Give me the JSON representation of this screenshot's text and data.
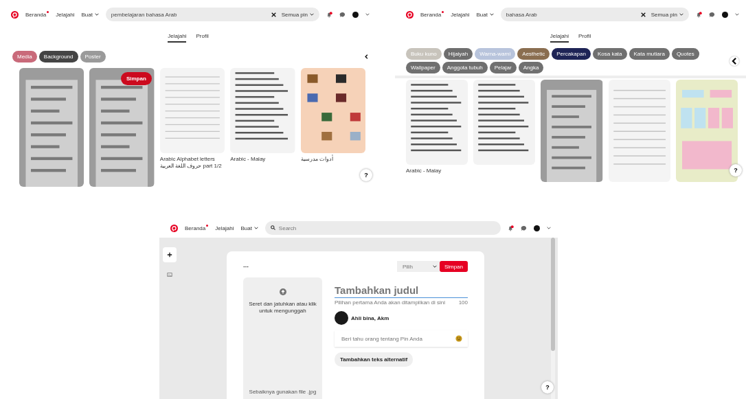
{
  "search_page_1": {
    "nav": [
      {
        "label": "Beranda",
        "kind": "link",
        "new_dot": true
      },
      {
        "label": "Jelajahi",
        "kind": "link",
        "new_dot": false
      },
      {
        "label": "Buat",
        "kind": "menu",
        "new_dot": false
      }
    ],
    "search": {
      "value": "pembelajaran bahasa Arab",
      "filter": "Semua pin"
    },
    "tabs": [
      {
        "label": "Jelajahi",
        "selected": true
      },
      {
        "label": "Profil",
        "selected": false
      }
    ],
    "chips": [
      {
        "label": "Media",
        "color": "#c96a7a"
      },
      {
        "label": "Background",
        "color": "#444444"
      },
      {
        "label": "Poster",
        "color": "#9a9a9a"
      }
    ],
    "pins": [
      {
        "kind": "picture"
      },
      {
        "kind": "picture",
        "save_button": "Simpan"
      },
      {
        "kind": "picture",
        "caption": "Arabic Alphabet letters حروف اللغة العربية part 1/2"
      },
      {
        "kind": "picture",
        "caption": "Arabic - Malay"
      },
      {
        "kind": "picture",
        "caption": "أدوات مدرسية"
      }
    ],
    "help": "?"
  },
  "search_page_2": {
    "nav": [
      {
        "label": "Beranda",
        "kind": "link",
        "new_dot": true
      },
      {
        "label": "Jelajahi",
        "kind": "link",
        "new_dot": false
      },
      {
        "label": "Buat",
        "kind": "menu",
        "new_dot": false
      }
    ],
    "search": {
      "value": "bahasa Arab",
      "filter": "Semua pin"
    },
    "tabs": [
      {
        "label": "Jelajahi",
        "selected": true
      },
      {
        "label": "Profil",
        "selected": false
      }
    ],
    "chips": [
      {
        "label": "Buku kuno",
        "color": "#c8c4bc"
      },
      {
        "label": "Hijaiyah",
        "color": "#6e6e6e"
      },
      {
        "label": "Warna-warni",
        "color": "#b8c4dc"
      },
      {
        "label": "Aesthetic",
        "color": "#8a6e50"
      },
      {
        "label": "Percakapan",
        "color": "#1e2456"
      },
      {
        "label": "Kosa kata",
        "color": "#707070"
      },
      {
        "label": "Kata mutiara",
        "color": "#707070"
      },
      {
        "label": "Quotes",
        "color": "#707070"
      },
      {
        "label": "Wallpaper",
        "color": "#707070"
      },
      {
        "label": "Anggota tubuh",
        "color": "#707070"
      },
      {
        "label": "Pelajar",
        "color": "#707070"
      },
      {
        "label": "Angka",
        "color": "#707070"
      }
    ],
    "pins": [
      {
        "kind": "picture",
        "caption": "Arabic - Malay"
      },
      {
        "kind": "picture"
      },
      {
        "kind": "picture"
      },
      {
        "kind": "picture"
      },
      {
        "kind": "picture"
      }
    ],
    "help": "?"
  },
  "create_pin_page": {
    "nav": [
      {
        "label": "Beranda",
        "kind": "link",
        "new_dot": true
      },
      {
        "label": "Jelajahi",
        "kind": "link",
        "new_dot": false
      },
      {
        "label": "Buat",
        "kind": "menu",
        "new_dot": false
      }
    ],
    "search": {
      "placeholder": "Search"
    },
    "board_select": "Pilih",
    "save_button": "Simpan",
    "upload": {
      "text": "Seret dan jatuhkan atau klik untuk mengunggah",
      "hint": "Sebaiknya gunakan file .jpg"
    },
    "title_field": {
      "placeholder": "Tambahkan judul",
      "hint": "Pilihan pertama Anda akan ditampilkan di sini",
      "counter": "100"
    },
    "user_name": "Ahli bina, Akm",
    "description_field": {
      "placeholder": "Beri tahu orang tentang Pin Anda"
    },
    "alt_text_button": "Tambahkan teks alternatif",
    "help": "?"
  }
}
